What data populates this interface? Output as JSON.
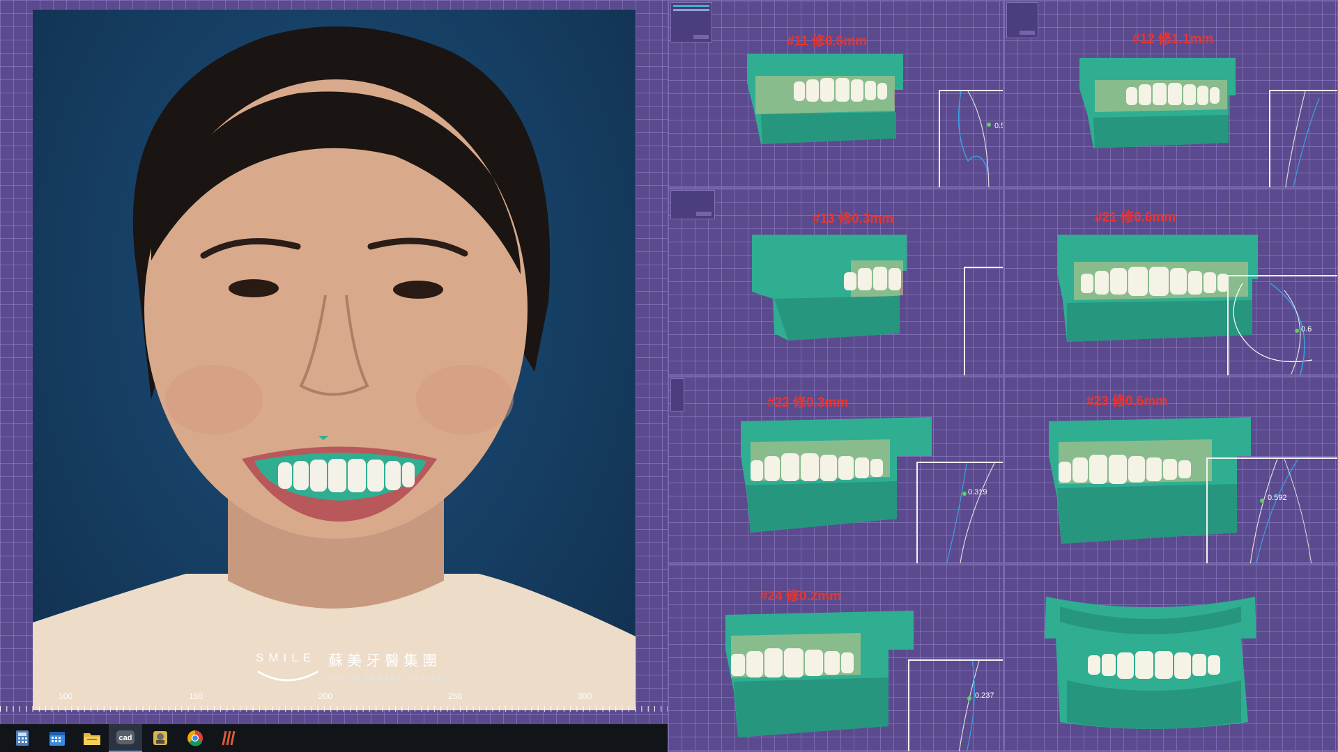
{
  "photo": {
    "logo": {
      "word": "SMILE",
      "chinese": "蘇美牙醫集團",
      "english": "SMILE DENTAL OFFICE"
    }
  },
  "ruler": {
    "labels": [
      "100",
      "150",
      "200",
      "250",
      "300"
    ]
  },
  "taskbar": {
    "apps": [
      {
        "icon": "calculator-icon",
        "label": ""
      },
      {
        "icon": "calendar-icon",
        "label": ""
      },
      {
        "icon": "folder-icon",
        "label": ""
      },
      {
        "icon": "cad-app-icon",
        "label": "cad"
      },
      {
        "icon": "printer-app-icon",
        "label": ""
      },
      {
        "icon": "chrome-icon",
        "label": ""
      },
      {
        "icon": "stripes-app-icon",
        "label": ""
      }
    ]
  },
  "panels": [
    {
      "tooth": "#11",
      "label": "#11 修0.6mm",
      "value": "0.5"
    },
    {
      "tooth": "#12",
      "label": "#12 修1.1mm",
      "value": ""
    },
    {
      "tooth": "#13",
      "label": "#13 修0.3mm",
      "value": ""
    },
    {
      "tooth": "#21",
      "label": "#21 修0.6mm",
      "value": "0.6"
    },
    {
      "tooth": "#22",
      "label": "#22 修0.3mm",
      "value": "0.319"
    },
    {
      "tooth": "#23",
      "label": "#23 修0.6mm",
      "value": "0.592"
    },
    {
      "tooth": "#24",
      "label": "#24 修0.2mm",
      "value": "0.237"
    },
    {
      "tooth": "",
      "label": "",
      "value": ""
    }
  ],
  "colors": {
    "grid": "#5b4b8e",
    "model": "#2fae92",
    "label": "#e8352f"
  }
}
